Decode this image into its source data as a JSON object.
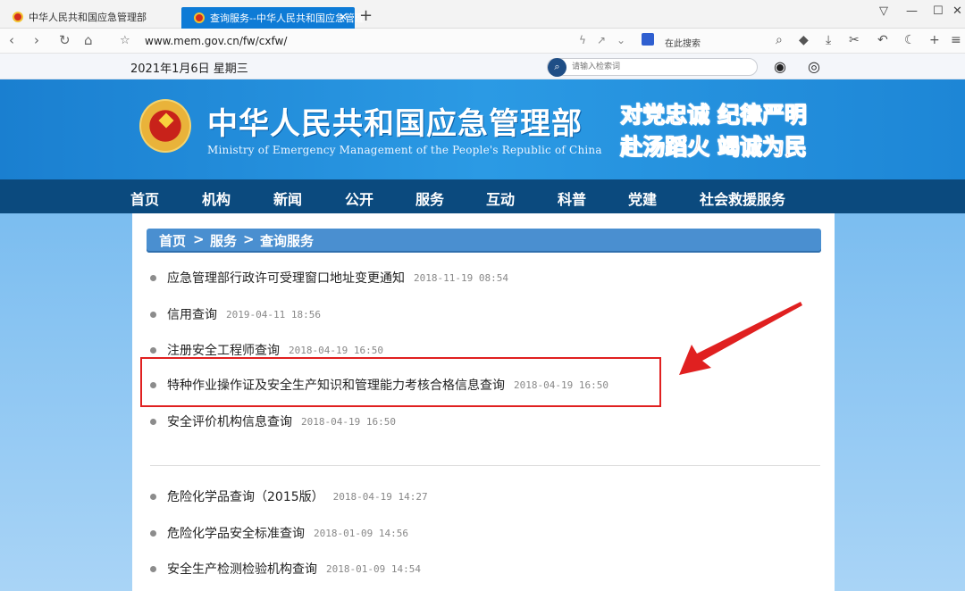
{
  "browser": {
    "tabs": [
      {
        "label": "中华人民共和国应急管理部",
        "active": false
      },
      {
        "label": "查询服务--中华人民共和国应急管理",
        "active": true
      }
    ],
    "url": "www.mem.gov.cn/fw/cxfw/",
    "search_engine_label": "在此搜索"
  },
  "site": {
    "date": "2021年1月6日 星期三",
    "search_placeholder": "请输入检索词",
    "title": "中华人民共和国应急管理部",
    "subtitle": "Ministry of Emergency Management of the People's Republic of China",
    "slogan_line1": "对党忠诚 纪律严明",
    "slogan_line2": "赴汤蹈火 竭诚为民"
  },
  "nav": {
    "items": [
      "首页",
      "机构",
      "新闻",
      "公开",
      "服务",
      "互动",
      "科普",
      "党建",
      "社会救援服务"
    ]
  },
  "breadcrumb": {
    "home": "首页",
    "sep1": ">",
    "service": "服务",
    "sep2": ">",
    "current": "查询服务"
  },
  "items": [
    {
      "title": "应急管理部行政许可受理窗口地址变更通知",
      "date": "2018-11-19 08:54"
    },
    {
      "title": "信用查询",
      "date": "2019-04-11 18:56"
    },
    {
      "title": "注册安全工程师查询",
      "date": "2018-04-19 16:50"
    },
    {
      "title": "特种作业操作证及安全生产知识和管理能力考核合格信息查询",
      "date": "2018-04-19 16:50"
    },
    {
      "title": "安全评价机构信息查询",
      "date": "2018-04-19 16:50"
    },
    {
      "title": "危险化学品查询（2015版）",
      "date": "2018-04-19 14:27"
    },
    {
      "title": "危险化学品安全标准查询",
      "date": "2018-01-09 14:56"
    },
    {
      "title": "安全生产检测检验机构查询",
      "date": "2018-01-09 14:54"
    }
  ],
  "colors": {
    "tab_active": "#0e7bd6",
    "banner": "#2b9ae4",
    "main_nav": "#0b4a7e",
    "breadcrumb_bg": "#4a8fd0",
    "highlight_box": "#e02020"
  }
}
